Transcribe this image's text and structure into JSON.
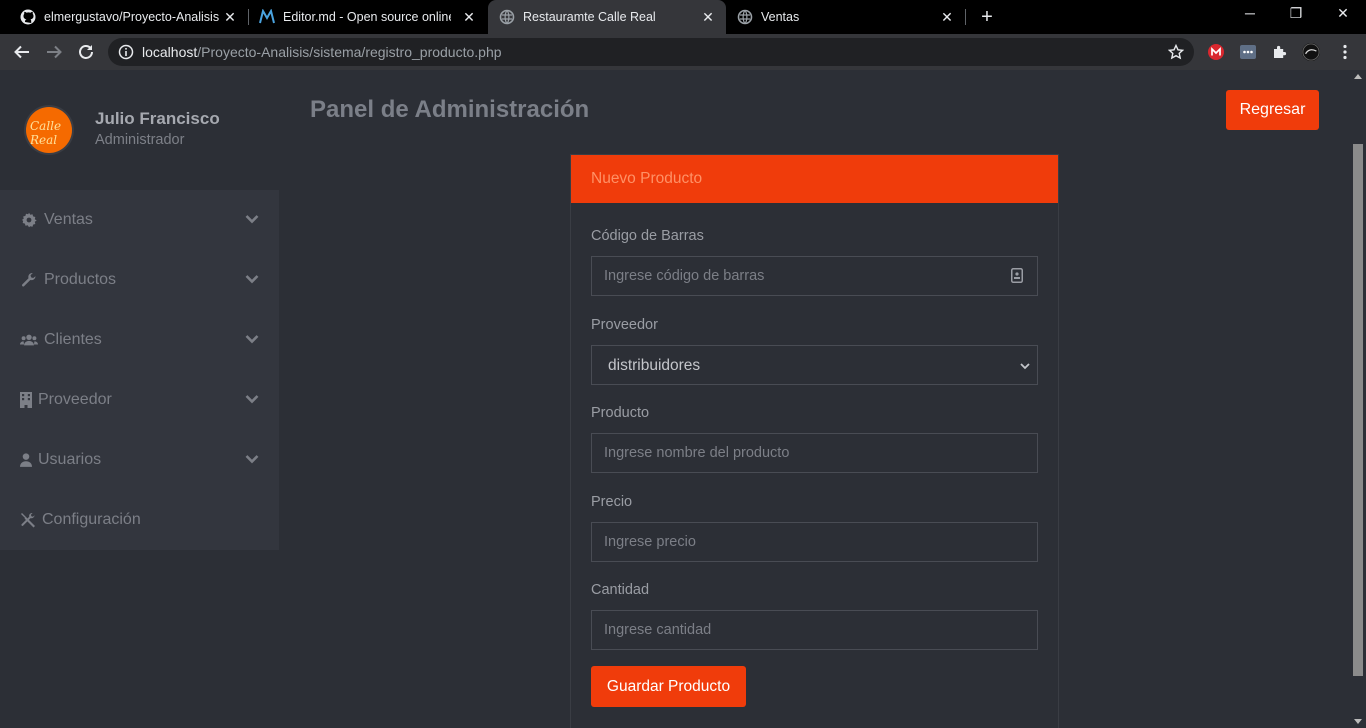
{
  "browser": {
    "tabs": [
      {
        "title": "elmergustavo/Proyecto-Analisis",
        "icon": "github-icon"
      },
      {
        "title": "Editor.md - Open source online M",
        "icon": "editor-md-icon"
      },
      {
        "title": "Restauramte Calle Real",
        "icon": "globe-icon"
      },
      {
        "title": "Ventas",
        "icon": "globe-icon"
      }
    ],
    "active_tab": 2,
    "url_host": "localhost",
    "url_path": "/Proyecto-Analisis/sistema/registro_producto.php"
  },
  "sidebar": {
    "user_name": "Julio Francisco",
    "user_role": "Administrador",
    "avatar_text": "Calle Real",
    "items": [
      {
        "label": "Ventas",
        "icon": "gear-icon",
        "has_children": true
      },
      {
        "label": "Productos",
        "icon": "wrench-icon",
        "has_children": true
      },
      {
        "label": "Clientes",
        "icon": "users-icon",
        "has_children": true
      },
      {
        "label": "Proveedor",
        "icon": "building-icon",
        "has_children": true
      },
      {
        "label": "Usuarios",
        "icon": "user-icon",
        "has_children": true
      },
      {
        "label": "Configuración",
        "icon": "tools-icon",
        "has_children": false
      }
    ]
  },
  "main": {
    "title": "Panel de Administración",
    "back_button": "Regresar",
    "card_title": "Nuevo Producto",
    "fields": {
      "barcode_label": "Código de Barras",
      "barcode_placeholder": "Ingrese código de barras",
      "provider_label": "Proveedor",
      "provider_value": "distribuidores",
      "product_label": "Producto",
      "product_placeholder": "Ingrese nombre del producto",
      "price_label": "Precio",
      "price_placeholder": "Ingrese precio",
      "quantity_label": "Cantidad",
      "quantity_placeholder": "Ingrese cantidad"
    },
    "save_button": "Guardar Producto"
  },
  "colors": {
    "accent": "#f03c0b",
    "background": "#2c2f36",
    "sidebar_menu": "#33363e"
  }
}
